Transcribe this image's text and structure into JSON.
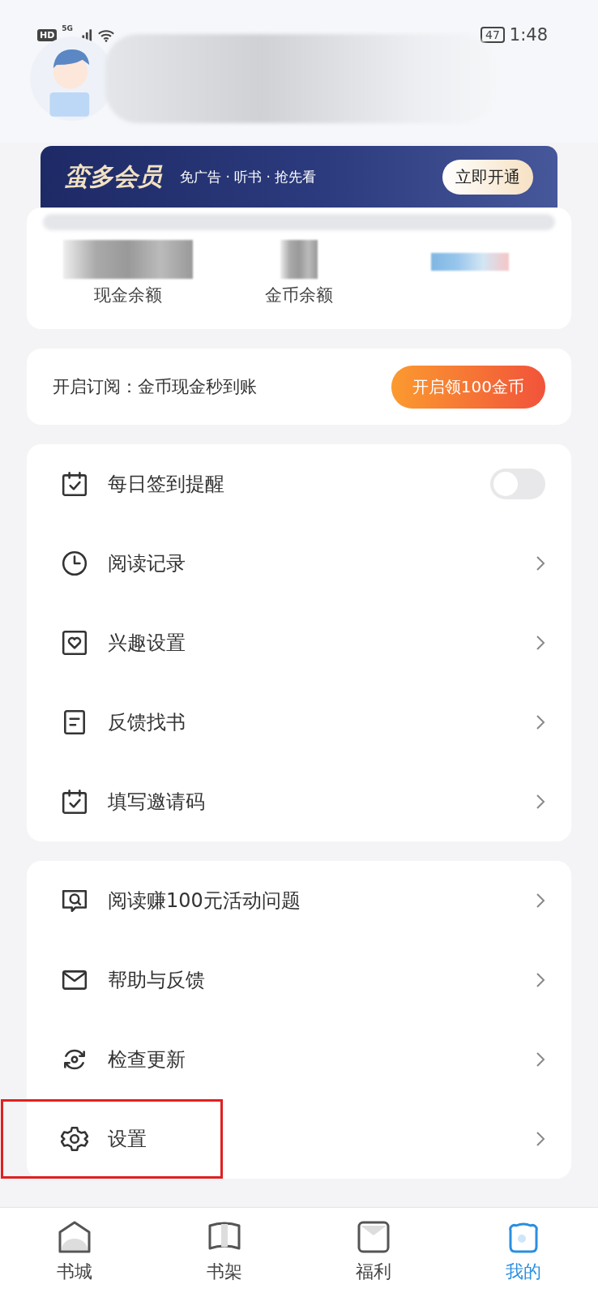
{
  "status_bar": {
    "badges": [
      "HD",
      "5G"
    ],
    "battery": "47",
    "time": "1:48"
  },
  "vip_banner": {
    "title": "蛮多会员",
    "perks": "免广告 · 听书 · 抢先看",
    "button": "立即开通"
  },
  "balances": [
    {
      "label": "现金余额"
    },
    {
      "label": "金币余额"
    }
  ],
  "subscribe": {
    "text": "开启订阅：金币现金秒到账",
    "button": "开启领100金币"
  },
  "menu_groups": [
    [
      {
        "kind": "toggle",
        "label": "每日签到提醒",
        "on": false,
        "highlighted": false
      },
      {
        "kind": "link",
        "label": "阅读记录",
        "highlighted": false
      },
      {
        "kind": "link",
        "label": "兴趣设置",
        "highlighted": false
      },
      {
        "kind": "link",
        "label": "反馈找书",
        "highlighted": false
      },
      {
        "kind": "link",
        "label": "填写邀请码",
        "highlighted": false
      }
    ],
    [
      {
        "kind": "link",
        "label": "阅读赚100元活动问题",
        "highlighted": false
      },
      {
        "kind": "link",
        "label": "帮助与反馈",
        "highlighted": false
      },
      {
        "kind": "link",
        "label": "检查更新",
        "highlighted": false
      },
      {
        "kind": "link",
        "label": "设置",
        "highlighted": true
      }
    ]
  ],
  "tabs": [
    {
      "label": "书城",
      "selected": false
    },
    {
      "label": "书架",
      "selected": false
    },
    {
      "label": "福利",
      "selected": false
    },
    {
      "label": "我的",
      "selected": true
    }
  ]
}
